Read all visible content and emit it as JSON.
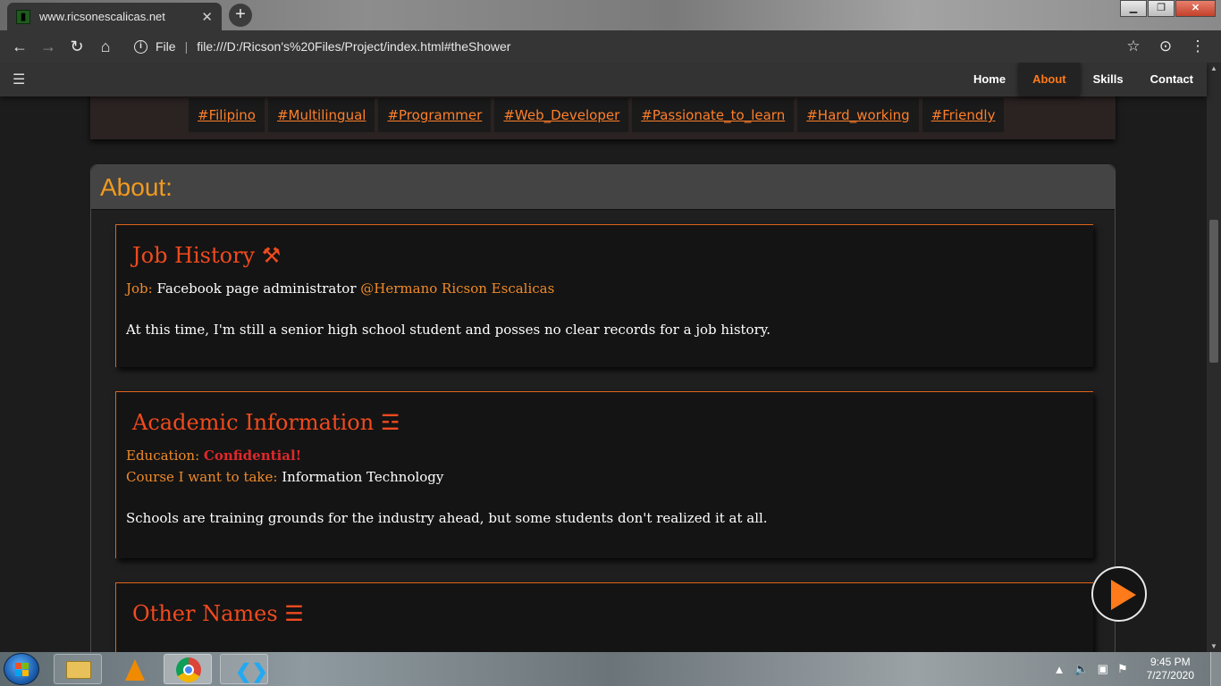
{
  "browser": {
    "tab_title": "www.ricsonescalicas.net",
    "tab_close": "✕",
    "new_tab": "+",
    "url_scheme_label": "File",
    "url": "file:///D:/Ricson's%20Files/Project/index.html#theShower",
    "icons": [
      "back-icon",
      "forward-icon",
      "reload-icon",
      "home-icon",
      "info-icon",
      "star-icon",
      "incognito-icon",
      "menu-icon"
    ]
  },
  "nav": {
    "items": [
      {
        "label": "Home"
      },
      {
        "label": "About"
      },
      {
        "label": "Skills"
      },
      {
        "label": "Contact"
      }
    ],
    "active": "About",
    "active_color": "#ff7a1a"
  },
  "tags": [
    "#Filipino",
    "#Multilingual",
    "#Programmer",
    "#Web_Developer",
    "#Passionate_to_learn",
    "#Hard_working",
    "#Friendly"
  ],
  "about": {
    "title": "About:",
    "job": {
      "heading": "Job History ⚒",
      "job_label": "Job:",
      "job_value": "Facebook page administrator",
      "job_handle": "@Hermano Ricson Escalicas",
      "note": "At this time, I'm still a senior high school student and posses no clear records for a job history."
    },
    "academic": {
      "heading": "Academic Information ☲",
      "education_label": "Education:",
      "education_value": "Confidential!",
      "course_label": "Course I want to take:",
      "course_value": "Information Technology",
      "note": "Schools are training grounds for the industry ahead, but some students don't realized it at all."
    },
    "other_names": {
      "heading": "Other Names ☰"
    }
  },
  "colors": {
    "accent_orange": "#f08a2a",
    "heading_red": "#f04a1e",
    "confidential_red": "#e0282a",
    "panel_title": "#f29a1f"
  },
  "taskbar": {
    "apps": [
      "file-explorer-icon",
      "vlc-icon",
      "chrome-icon",
      "vscode-icon"
    ],
    "time": "9:45 PM",
    "date": "7/27/2020"
  }
}
